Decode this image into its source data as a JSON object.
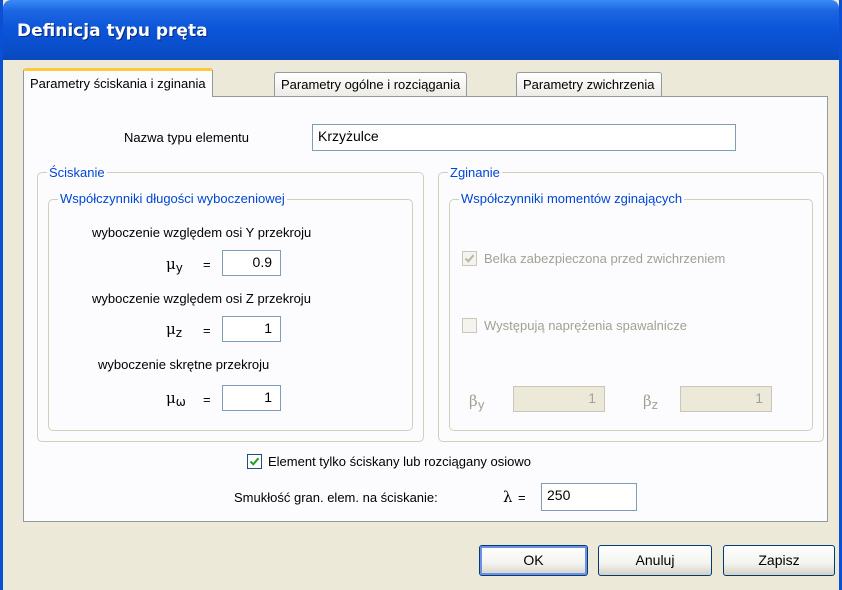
{
  "window": {
    "title": "Definicja typu pręta"
  },
  "tabs": [
    {
      "label": "Parametry ściskania i zginania",
      "active": true
    },
    {
      "label": "Parametry ogólne i rozciągania",
      "active": false
    },
    {
      "label": "Parametry zwichrzenia",
      "active": false
    }
  ],
  "name_field": {
    "label": "Nazwa typu elementu",
    "value": "Krzyżulce"
  },
  "compression": {
    "legend": "Ściskanie",
    "subgroup_legend": "Współczynniki długości wyboczeniowej",
    "y": {
      "label": "wyboczenie względem osi Y przekroju",
      "symbol": "μ",
      "sub": "y",
      "eq": "=",
      "value": "0.9"
    },
    "z": {
      "label": "wyboczenie względem osi Z przekroju",
      "symbol": "μ",
      "sub": "z",
      "eq": "=",
      "value": "1"
    },
    "torsion": {
      "label": "wyboczenie skrętne przekroju",
      "symbol": "μ",
      "sub": "ω",
      "eq": "=",
      "value": "1"
    }
  },
  "bending": {
    "legend": "Zginanie",
    "subgroup_legend": "Współczynniki momentów zginających",
    "secured_checkbox": {
      "label": "Belka zabezpieczona przed zwichrzeniem",
      "checked": true,
      "enabled": false
    },
    "welding_checkbox": {
      "label": "Występują naprężenia spawalnicze",
      "checked": false,
      "enabled": false
    },
    "beta_y": {
      "symbol": "β",
      "sub": "y",
      "value": "1"
    },
    "beta_z": {
      "symbol": "β",
      "sub": "z",
      "value": "1"
    }
  },
  "axial_checkbox": {
    "label": "Element tylko ściskany lub rozciągany osiowo",
    "checked": true
  },
  "slenderness": {
    "label": "Smukłość gran. elem. na ściskanie:",
    "symbol": "λ",
    "eq": "=",
    "value": "250"
  },
  "buttons": {
    "ok": "OK",
    "cancel": "Anuluj",
    "save": "Zapisz"
  },
  "colors": {
    "title_bar": "#0a55d8",
    "legend_text": "#0046d5",
    "dialog_bg": "#ece9d8",
    "panel_bg": "#fcfcfe"
  }
}
